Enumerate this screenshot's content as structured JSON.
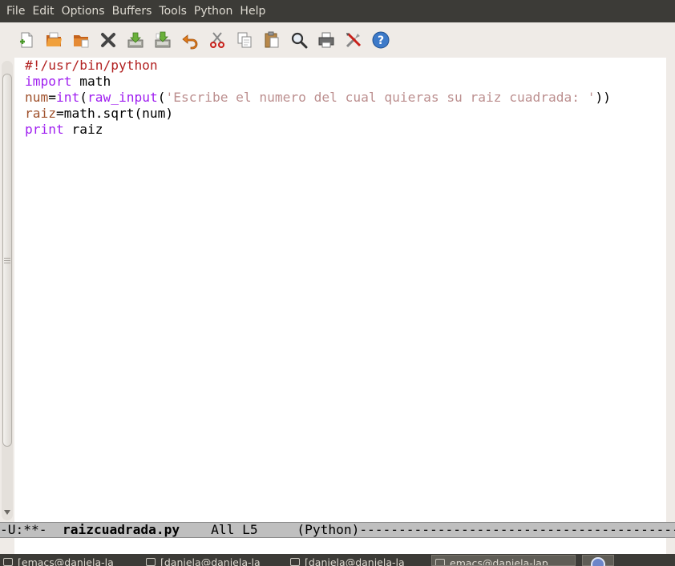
{
  "menubar": {
    "items": [
      "File",
      "Edit",
      "Options",
      "Buffers",
      "Tools",
      "Python",
      "Help"
    ]
  },
  "toolbar": {
    "icons": [
      "new-file-icon",
      "open-file-icon",
      "open-directory-icon",
      "close-buffer-icon",
      "save-icon",
      "save-as-icon",
      "undo-icon",
      "cut-icon",
      "copy-icon",
      "paste-icon",
      "search-icon",
      "print-icon",
      "preferences-icon",
      "help-icon"
    ]
  },
  "editor": {
    "lines": [
      [
        {
          "t": "#!/usr/bin/python",
          "c": "comment"
        }
      ],
      [
        {
          "t": "import",
          "c": "keyword"
        },
        {
          "t": " math",
          "c": ""
        }
      ],
      [
        {
          "t": "num",
          "c": "var"
        },
        {
          "t": "=",
          "c": ""
        },
        {
          "t": "int",
          "c": "builtin"
        },
        {
          "t": "(",
          "c": ""
        },
        {
          "t": "raw_input",
          "c": "builtin"
        },
        {
          "t": "(",
          "c": ""
        },
        {
          "t": "'Escribe el numero del cual quieras su raiz cuadrada: '",
          "c": "string"
        },
        {
          "t": "))",
          "c": ""
        }
      ],
      [
        {
          "t": "raiz",
          "c": "var"
        },
        {
          "t": "=math.sqrt(num)",
          "c": ""
        }
      ],
      [
        {
          "t": "print",
          "c": "keyword"
        },
        {
          "t": " raiz",
          "c": ""
        }
      ]
    ]
  },
  "modeline": {
    "status": "-U:**-  ",
    "buffer_name": "raizcuadrada.py",
    "position": "    All L5     ",
    "mode": "(Python)",
    "fill": "-------------------------------------------------------------------------------------"
  },
  "taskbar": {
    "tasks": [
      "[emacs@daniela-la",
      "[daniela@daniela-la",
      "[daniela@daniela-la",
      "emacs@daniela-lap"
    ],
    "active_index": 3
  },
  "colors": {
    "comment": "#b22222",
    "keyword": "#a020f0",
    "variable": "#a0522d",
    "string": "#bc8f8f",
    "menubar_bg": "#3c3b37"
  }
}
